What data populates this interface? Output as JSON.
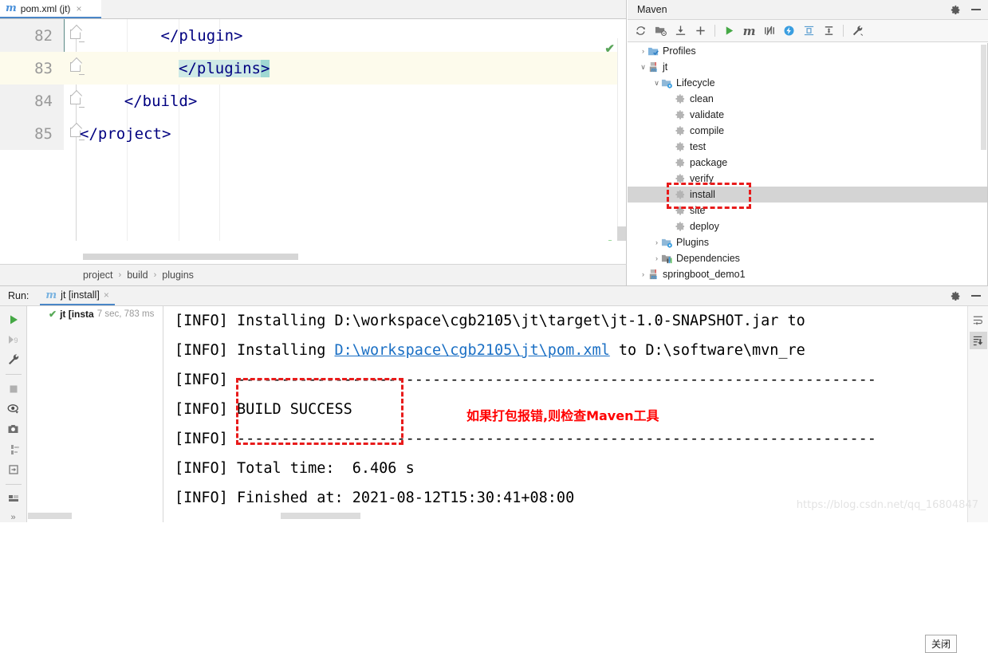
{
  "editor": {
    "tab": {
      "label": "pom.xml (jt)",
      "icon": "maven-m-icon",
      "close": "×"
    },
    "lines": [
      {
        "num": "82",
        "text": "</plugin>",
        "current": false
      },
      {
        "num": "83",
        "text": "</plugins>",
        "current": true
      },
      {
        "num": "84",
        "text": "</build>",
        "current": false
      },
      {
        "num": "85",
        "text": "</project>",
        "current": false
      }
    ],
    "line82_text": "        </plugin>",
    "line83_sel": "</plugins",
    "line83_caret": ">",
    "line84_text": "    </build>",
    "line85_text": "</project>",
    "breadcrumb": [
      "project",
      "build",
      "plugins"
    ],
    "breadcrumb_sep": "›"
  },
  "maven": {
    "title": "Maven",
    "toolbar": [
      "reload-icon",
      "collapse-folder-icon",
      "download-sources-icon",
      "add-icon",
      "run-icon",
      "execute-goal-icon",
      "skip-tests-icon",
      "offline-mode-icon",
      "show-dependencies-icon",
      "collapse-all-icon",
      "settings-wrench-icon"
    ],
    "header_controls": [
      "gear-icon",
      "minimize-icon"
    ],
    "tree": [
      {
        "label": "Profiles",
        "depth": 0,
        "twist": "›",
        "icon": "profiles-folder-icon",
        "selected": false
      },
      {
        "label": "jt",
        "depth": 0,
        "twist": "∨",
        "icon": "maven-project-icon",
        "selected": false
      },
      {
        "label": "Lifecycle",
        "depth": 1,
        "twist": "∨",
        "icon": "lifecycle-folder-icon",
        "selected": false
      },
      {
        "label": "clean",
        "depth": 2,
        "twist": "",
        "icon": "goal-gear-icon",
        "selected": false
      },
      {
        "label": "validate",
        "depth": 2,
        "twist": "",
        "icon": "goal-gear-icon",
        "selected": false
      },
      {
        "label": "compile",
        "depth": 2,
        "twist": "",
        "icon": "goal-gear-icon",
        "selected": false
      },
      {
        "label": "test",
        "depth": 2,
        "twist": "",
        "icon": "goal-gear-icon",
        "selected": false
      },
      {
        "label": "package",
        "depth": 2,
        "twist": "",
        "icon": "goal-gear-icon",
        "selected": false
      },
      {
        "label": "verify",
        "depth": 2,
        "twist": "",
        "icon": "goal-gear-icon",
        "selected": false
      },
      {
        "label": "install",
        "depth": 2,
        "twist": "",
        "icon": "goal-gear-icon",
        "selected": true
      },
      {
        "label": "site",
        "depth": 2,
        "twist": "",
        "icon": "goal-gear-icon",
        "selected": false
      },
      {
        "label": "deploy",
        "depth": 2,
        "twist": "",
        "icon": "goal-gear-icon",
        "selected": false
      },
      {
        "label": "Plugins",
        "depth": 1,
        "twist": "›",
        "icon": "plugins-folder-icon",
        "selected": false
      },
      {
        "label": "Dependencies",
        "depth": 1,
        "twist": "›",
        "icon": "dependencies-folder-icon",
        "selected": false
      },
      {
        "label": "springboot_demo1",
        "depth": 0,
        "twist": "›",
        "icon": "maven-project-icon",
        "selected": false
      }
    ]
  },
  "run": {
    "label": "Run:",
    "tab": {
      "label": "jt [install]",
      "icon": "maven-m-icon",
      "close": "×"
    },
    "header_controls": [
      "gear-icon",
      "minimize-icon"
    ],
    "side_buttons": [
      "rerun-icon",
      "rerun-failed-icon",
      "wrench-icon",
      "stop-icon",
      "filter-eye-icon",
      "camera-icon",
      "thread-dump-icon",
      "export-icon",
      "console-layout-icon",
      "expand-more-icon"
    ],
    "side_more": "»",
    "tree_row": {
      "status": "✔",
      "name": "jt [insta",
      "duration": "7 sec, 783 ms"
    },
    "console_right_buttons": [
      "soft-wrap-icon",
      "scroll-to-end-icon"
    ],
    "console": [
      {
        "pre": "[INFO] Installing D:\\workspace\\cgb2105\\jt\\target\\jt-1.0-SNAPSHOT.jar to",
        "link": "",
        "post": ""
      },
      {
        "pre": "[INFO] Installing ",
        "link": "D:\\workspace\\cgb2105\\jt\\pom.xml",
        "post": " to D:\\software\\mvn_re"
      },
      {
        "pre": "[INFO] ------------------------------------------------------------------------",
        "link": "",
        "post": ""
      },
      {
        "pre": "[INFO] BUILD SUCCESS",
        "link": "",
        "post": ""
      },
      {
        "pre": "[INFO] ------------------------------------------------------------------------",
        "link": "",
        "post": ""
      },
      {
        "pre": "[INFO] Total time:  6.406 s",
        "link": "",
        "post": ""
      },
      {
        "pre": "[INFO] Finished at: 2021-08-12T15:30:41+08:00",
        "link": "",
        "post": ""
      }
    ]
  },
  "tooltip": {
    "close_text": "关闭"
  },
  "annotations": {
    "note": "如果打包报错,则检查Maven工具",
    "highlight_color": "#e81b1b",
    "text_color": "#ff0000"
  },
  "watermark": "https://blog.csdn.net/qq_16804847"
}
